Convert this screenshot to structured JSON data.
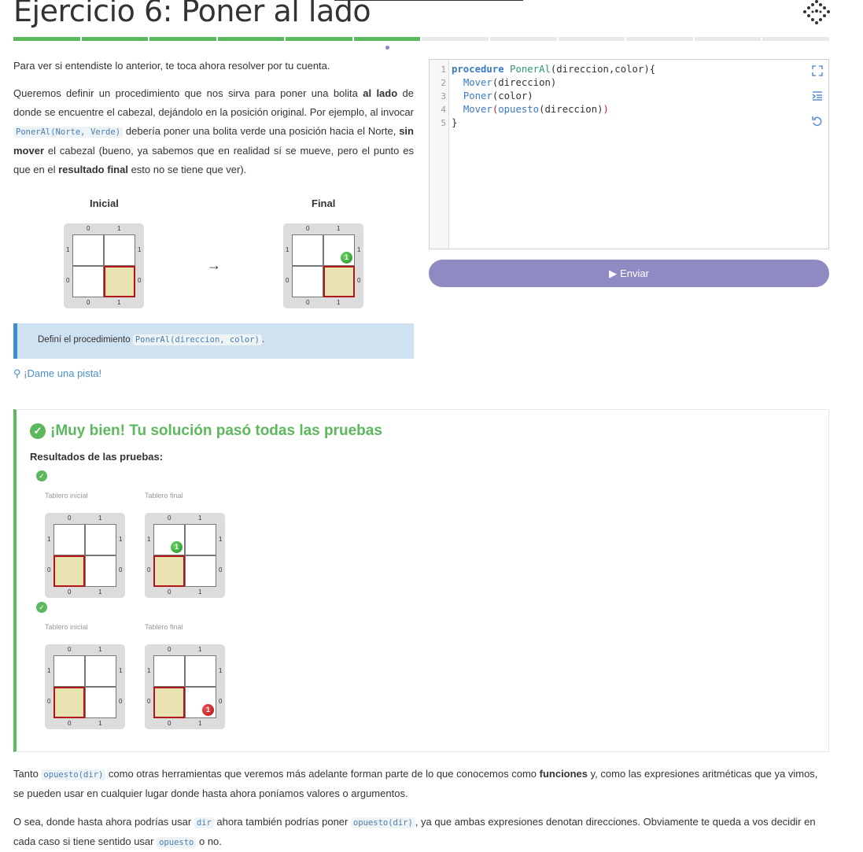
{
  "title": "Ejercicio 6: Poner al lado",
  "progress": {
    "total": 12,
    "done": 6
  },
  "intro": "Para ver si entendiste lo anterior, te toca ahora resolver por tu cuenta.",
  "p2": {
    "a": "Queremos definir un procedimiento que nos sirva para poner una bolita ",
    "b": "al lado",
    "c": " de donde se encuentre el cabezal, dejándolo en la posición original. Por ejemplo, al invocar ",
    "code": "PonerAl(Norte, Verde)",
    "d": " debería poner una bolita verde una posición hacia el Norte, ",
    "e": "sin mover",
    "f": " el cabezal (bueno, ya sabemos que en realidad sí se mueve, pero el punto es que en el ",
    "g": "resultado final",
    "h": " esto no se tiene que ver)."
  },
  "boards": {
    "initial_label": "Inicial",
    "final_label": "Final",
    "arrow": "→",
    "ax0": "0",
    "ax1": "1",
    "ball_count": "1"
  },
  "info": {
    "text": "Definí el procedimiento ",
    "code": "PonerAl(direccion, color)",
    "end": "."
  },
  "hint": {
    "icon": "lightbulb-icon",
    "label": "¡Dame una pista!"
  },
  "editor": {
    "line_numbers": [
      "1",
      "2",
      "3",
      "4",
      "5"
    ],
    "l1_kw": "procedure",
    "l1_fn": "PonerAl",
    "l1_rest": "(direccion,color){",
    "l2_bi": "Mover",
    "l2_rest": "(direccion)",
    "l3_bi": "Poner",
    "l3_rest": "(color)",
    "l4_bi": "Mover",
    "l4_p1": "(",
    "l4_bi2": "opuesto",
    "l4_rest": "(direccion)",
    "l4_p2": ")",
    "l5": "}"
  },
  "submit": {
    "label": "Enviar",
    "icon": "play-icon"
  },
  "result": {
    "title": "¡Muy bien! Tu solución pasó todas las pruebas",
    "heading": "Resultados de las pruebas:",
    "initial_board_label": "Tablero inicial",
    "final_board_label": "Tablero final"
  },
  "bottom1": {
    "a": "Tanto ",
    "code": "opuesto(dir)",
    "b": " como otras herramientas que veremos más adelante forman parte de lo que conocemos como ",
    "bold": "funciones",
    "c": " y, como las expresiones aritméticas que ya vimos, se pueden usar en cualquier lugar donde hasta ahora poníamos valores o argumentos."
  },
  "bottom2": {
    "a": "O sea, donde hasta ahora podrías usar ",
    "code1": "dir",
    "b": " ahora también podrías poner ",
    "code2": "opuesto(dir)",
    "c": ", ya que ambas expresiones denotan direcciones. Obviamente te queda a vos decidir en cada caso si tiene sentido usar ",
    "code3": "opuesto",
    "d": " o no."
  },
  "colors": {
    "accent": "#5cb85c",
    "button": "#908ac2",
    "info_bg": "#cfe2f2",
    "head_cell": "#e8e3b0",
    "head_border": "#b1161b"
  }
}
